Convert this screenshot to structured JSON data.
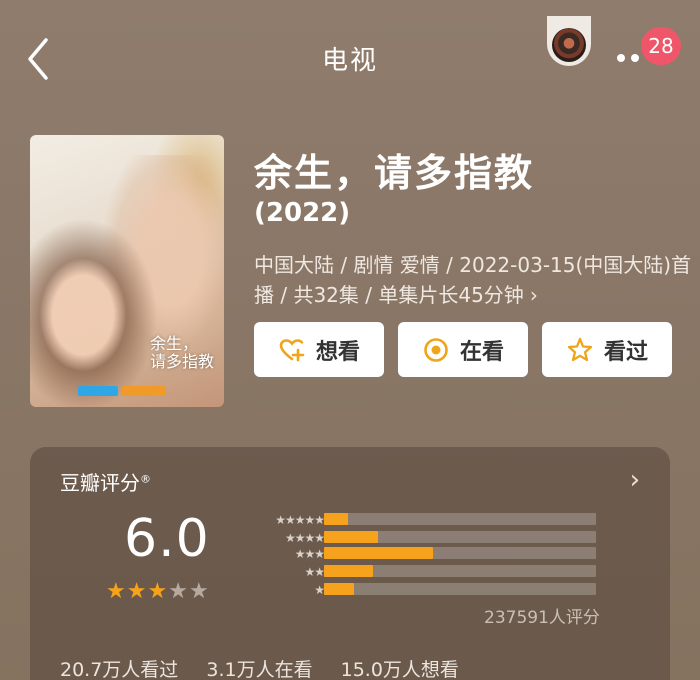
{
  "header": {
    "title": "电视",
    "badge_count": "28"
  },
  "show": {
    "title": "余生，请多指教",
    "year": "(2022)",
    "meta": "中国大陆 / 剧情 爱情 / 2022-03-15(中国大陆)首播 / 共32集 / 单集片长45分钟",
    "poster_logo_1": "余生，",
    "poster_logo_2": "请多指教"
  },
  "actions": {
    "want": "想看",
    "watching": "在看",
    "watched": "看过"
  },
  "rating": {
    "title": "豆瓣评分",
    "title_mark": "®",
    "score": "6.0",
    "stars_filled": 3,
    "stars_total": 5,
    "distribution": [
      {
        "stars": "★★★★★",
        "fraction": 0.09
      },
      {
        "stars": "★★★★",
        "fraction": 0.2
      },
      {
        "stars": "★★★",
        "fraction": 0.4
      },
      {
        "stars": "★★",
        "fraction": 0.18
      },
      {
        "stars": "★",
        "fraction": 0.11
      }
    ],
    "votes": "237591人评分",
    "watched_count": "20.7万人看过",
    "watching_count": "3.1万人在看",
    "want_count": "15.0万人想看"
  },
  "colors": {
    "accent": "#f7a21c",
    "badge": "#f0566a",
    "background": "#8a7768"
  }
}
